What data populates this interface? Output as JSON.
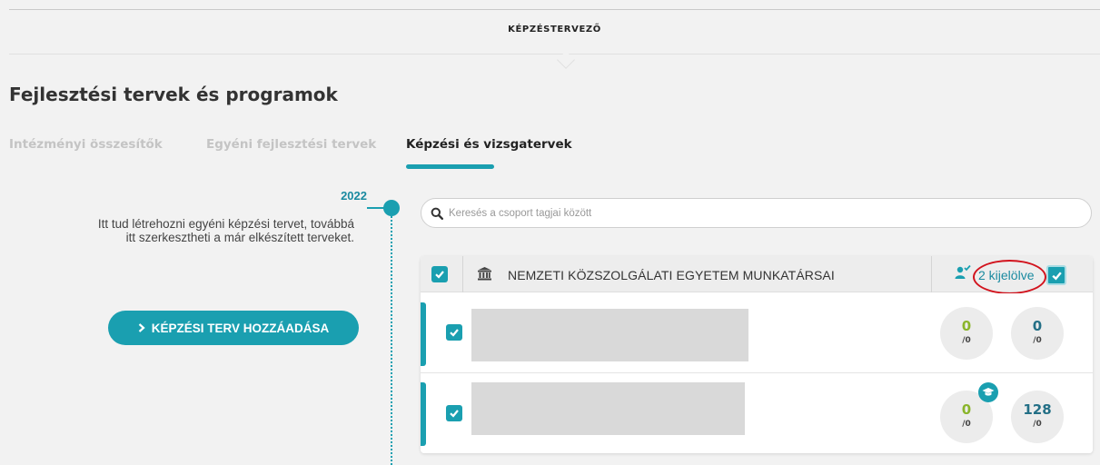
{
  "header": {
    "title": "KÉPZÉSTERVEZŐ"
  },
  "page": {
    "title": "Fejlesztési tervek és programok"
  },
  "tabs": [
    {
      "label": "Intézményi összesítők",
      "active": false
    },
    {
      "label": "Egyéni fejlesztési tervek",
      "active": false
    },
    {
      "label": "Képzési és vizsgatervek",
      "active": true
    }
  ],
  "timeline": {
    "year": "2022",
    "description": "Itt tud létrehozni egyéni képzési tervet, továbbá itt szerkesztheti a már elkészített terveket.",
    "add_button_label": "KÉPZÉSI TERV HOZZÁADÁSA"
  },
  "search": {
    "placeholder": "Keresés a csoport tagjai között",
    "value": ""
  },
  "group": {
    "name": "NEMZETI KÖZSZOLGÁLATI EGYETEM MUNKATÁRSAI",
    "selected_label": "2 kijelölve",
    "all_checked": true,
    "members": [
      {
        "checked": true,
        "stat1_num": "0",
        "stat1_den": "/0",
        "stat2_num": "0",
        "stat2_den": "/0",
        "graduated": false
      },
      {
        "checked": true,
        "stat1_num": "0",
        "stat1_den": "/0",
        "stat2_num": "128",
        "stat2_den": "/0",
        "graduated": true
      }
    ]
  },
  "colors": {
    "accent": "#1a9fb0",
    "accent_dark": "#1a8aa0",
    "stat_green": "#8ab52b",
    "stat_teal": "#236f86",
    "highlight": "#d2131d",
    "placeholder_gray": "#d9d9d9"
  },
  "icons": {
    "search": "search-icon",
    "institution": "institution-icon",
    "users_selected": "users-check-icon",
    "checkbox": "checkmark-icon",
    "graduation": "graduation-cap-icon",
    "chevron": "chevron-right-icon"
  }
}
